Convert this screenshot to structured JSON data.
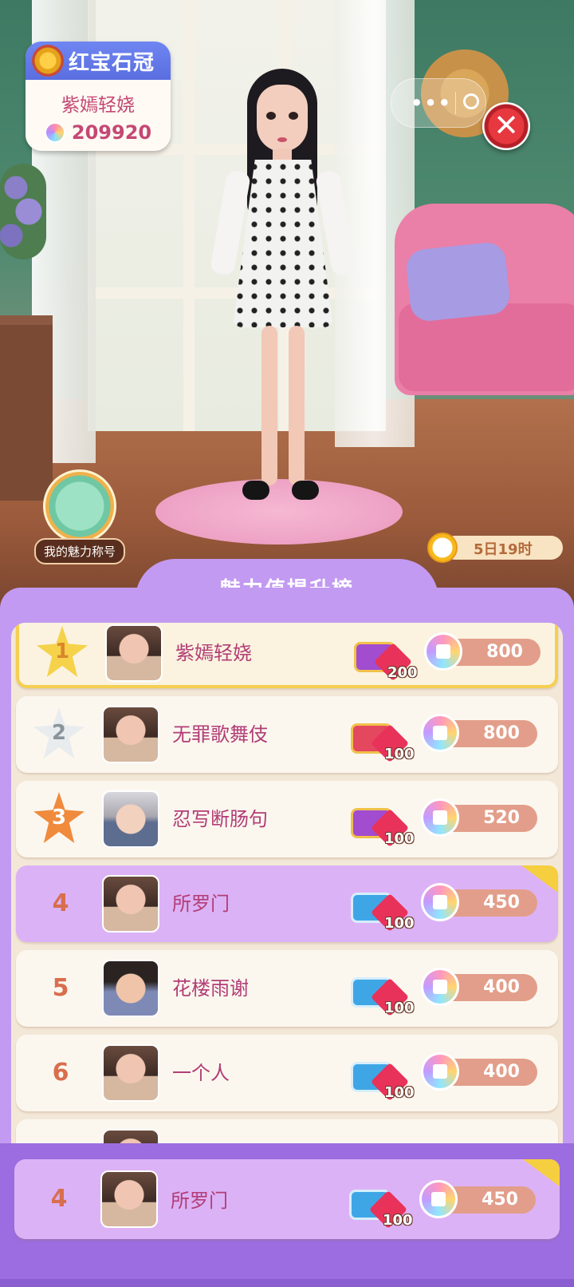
{
  "title_card": {
    "title": "红宝石冠",
    "player_name": "紫嫣轻娆",
    "score": "209920"
  },
  "top_capsule": {
    "more_glyph": "•••"
  },
  "close_glyph": "✕",
  "charm_title_label": "我的魅力称号",
  "timer_text": "5日19时",
  "leaderboard": {
    "title": "魅力值提升榜",
    "rows": [
      {
        "rank": "1",
        "name": "紫嫣轻娆",
        "gift_count": "200",
        "charm": "800"
      },
      {
        "rank": "2",
        "name": "无罪歌舞伎",
        "gift_count": "100",
        "charm": "800"
      },
      {
        "rank": "3",
        "name": "忍写断肠句",
        "gift_count": "100",
        "charm": "520"
      },
      {
        "rank": "4",
        "name": "所罗门",
        "gift_count": "100",
        "charm": "450"
      },
      {
        "rank": "5",
        "name": "花楼雨谢",
        "gift_count": "100",
        "charm": "400"
      },
      {
        "rank": "6",
        "name": "一个人",
        "gift_count": "100",
        "charm": "400"
      }
    ],
    "my_row": {
      "rank": "4",
      "name": "所罗门",
      "gift_count": "100",
      "charm": "450"
    }
  }
}
